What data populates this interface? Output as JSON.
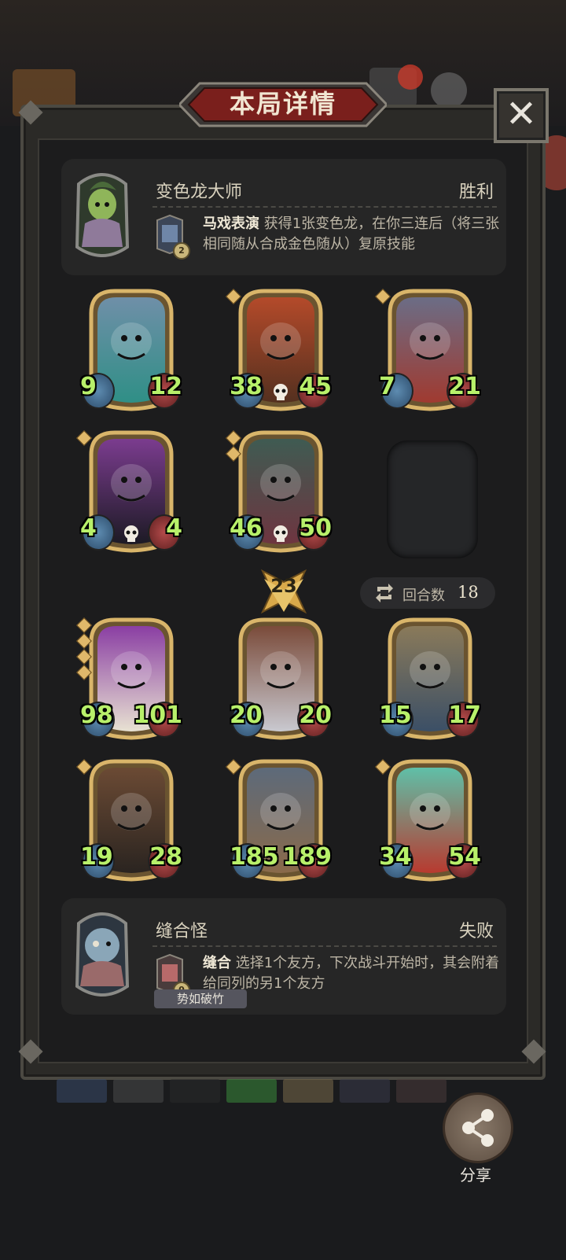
{
  "title": "本局详情",
  "close_label": "✕",
  "player": {
    "hero_name": "变色龙大师",
    "result": "胜利",
    "power_cost": "2",
    "power_name": "马戏表演",
    "power_desc": "获得1张变色龙，在你三连后（将三张相同随从合成金色随从）复原技能"
  },
  "player_board": [
    {
      "attack": "9",
      "health": "12",
      "tier_dots": 0,
      "colors": [
        "#6f8fa8",
        "#2f8f86"
      ]
    },
    {
      "attack": "38",
      "health": "45",
      "tier_dots": 1,
      "colors": [
        "#b44a2a",
        "#54301f"
      ]
    },
    {
      "attack": "7",
      "health": "21",
      "tier_dots": 1,
      "colors": [
        "#6b6d86",
        "#a03a30"
      ]
    },
    {
      "attack": "4",
      "health": "4",
      "tier_dots": 1,
      "colors": [
        "#7b3c8f",
        "#1c1a24"
      ]
    },
    {
      "attack": "46",
      "health": "50",
      "tier_dots": 2,
      "colors": [
        "#3f5b52",
        "#6e3540"
      ]
    }
  ],
  "tavern_tier": "23",
  "turns": {
    "label": "回合数",
    "value": "18"
  },
  "opponent_board": [
    {
      "attack": "98",
      "health": "101",
      "tier_dots": 4,
      "colors": [
        "#8a3ea3",
        "#e8e2d2"
      ]
    },
    {
      "attack": "20",
      "health": "20",
      "tier_dots": 0,
      "colors": [
        "#7a4b3a",
        "#c9c9d0"
      ]
    },
    {
      "attack": "15",
      "health": "17",
      "tier_dots": 0,
      "colors": [
        "#8a7a5a",
        "#3b4f66"
      ]
    },
    {
      "attack": "19",
      "health": "28",
      "tier_dots": 1,
      "colors": [
        "#6b4a34",
        "#2a2420"
      ]
    },
    {
      "attack": "185",
      "health": "189",
      "tier_dots": 1,
      "colors": [
        "#5d6a7a",
        "#8a6a4a"
      ]
    },
    {
      "attack": "34",
      "health": "54",
      "tier_dots": 1,
      "colors": [
        "#5fc0a8",
        "#b83a2f"
      ]
    }
  ],
  "opponent": {
    "hero_name": "缝合怪",
    "result": "失败",
    "power_cost": "0",
    "power_name": "缝合",
    "power_desc": "选择1个友方，下次战斗开始时，其会附着给同列的另1个友方",
    "tag": "势如破竹"
  },
  "share_label": "分享",
  "colors": {
    "stat_green": "#b8f06a",
    "gold_frame": "#c9a45a",
    "title_red": "#7a1f1c"
  }
}
